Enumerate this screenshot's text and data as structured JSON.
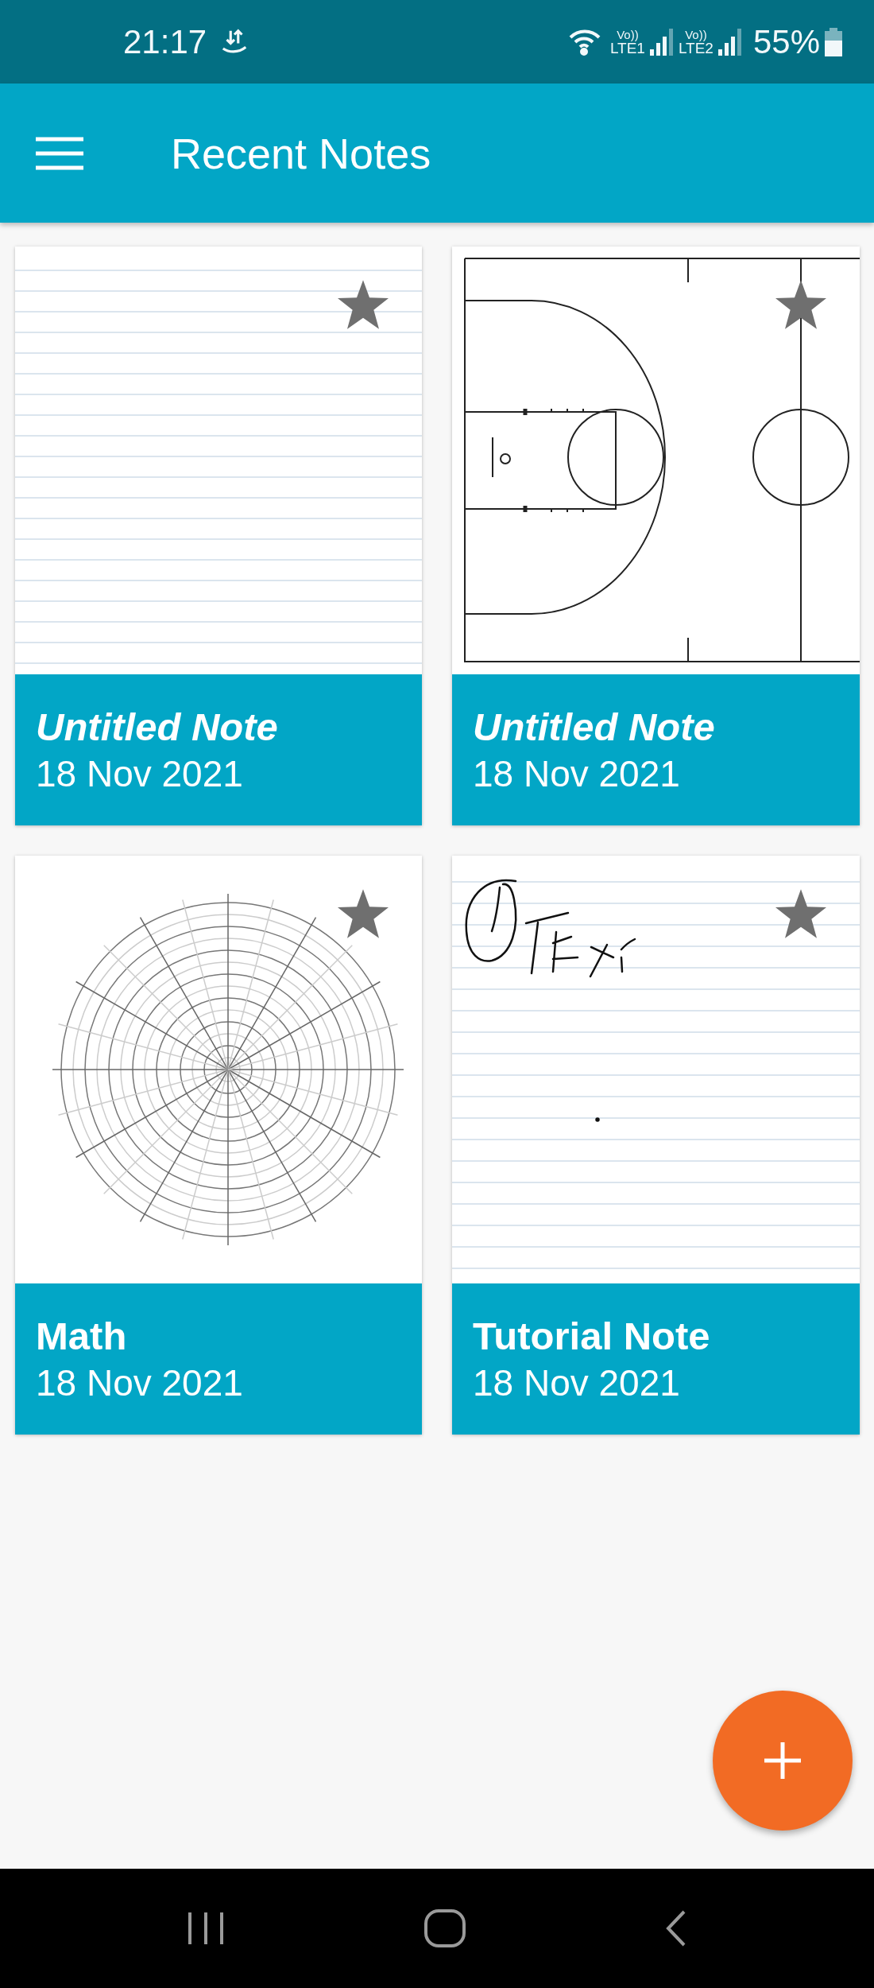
{
  "status_bar": {
    "time": "21:17",
    "sim_1": {
      "volte": "Vo))",
      "network": "LTE1"
    },
    "sim_2": {
      "volte": "Vo))",
      "network": "LTE2"
    },
    "battery": "55%"
  },
  "app_bar": {
    "title": "Recent Notes"
  },
  "notes": [
    {
      "title": "Untitled Note",
      "untitled": true,
      "date": "18 Nov 2021",
      "kind": "lined"
    },
    {
      "title": "Untitled Note",
      "untitled": true,
      "date": "18 Nov 2021",
      "kind": "court"
    },
    {
      "title": "Math",
      "untitled": false,
      "date": "18 Nov 2021",
      "kind": "polar"
    },
    {
      "title": "Tutorial Note",
      "untitled": false,
      "date": "18 Nov 2021",
      "kind": "handwritten"
    }
  ]
}
